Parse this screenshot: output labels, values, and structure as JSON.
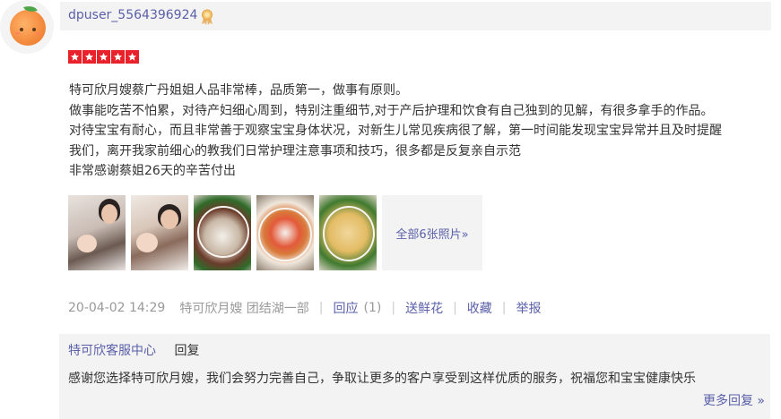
{
  "user": {
    "name": "dpuser_5564396924",
    "avatar_icon": "orange-avatar-icon",
    "badge_icon": "medal-badge-icon"
  },
  "rating": {
    "stars": 5,
    "max": 5,
    "color": "#e8212a"
  },
  "review_lines": [
    "特可欣月嫂蔡广丹姐姐人品非常棒，品质第一，做事有原则。",
    "做事能吃苦不怕累，对待产妇细心周到，特别注重细节,对于产后护理和饮食有自己独到的见解，有很多拿手的作品。",
    "对待宝宝有耐心，而且非常善于观察宝宝身体状况，对新生儿常见疾病很了解，第一时间能发现宝宝异常并且及时提醒",
    "我们，离开我家前细心的教我们日常护理注意事项和技巧，很多都是反复亲自示范",
    "非常感谢蔡姐26天的辛苦付出"
  ],
  "photos": {
    "items": [
      "photo-mother-baby-1",
      "photo-mother-baby-2",
      "photo-dish-meat-veg",
      "photo-dish-tomato",
      "photo-dish-fried"
    ],
    "more_label": "全部6张照片»"
  },
  "meta": {
    "datetime": "20-04-02 14:29",
    "shop": "特可欣月嫂 团结湖一部",
    "reply_label": "回应",
    "reply_count": "(1)",
    "flower_label": "送鲜花",
    "favorite_label": "收藏",
    "report_label": "举报"
  },
  "merchant_reply": {
    "merchant": "特可欣客服中心",
    "label": "回复",
    "text": "感谢您选择特可欣月嫂，我们会努力完善自己，争取让更多的客户享受到这样优质的服务，祝福您和宝宝健康快乐",
    "more_label": "更多回复 »"
  },
  "colors": {
    "link": "#5a5fa8",
    "muted": "#999999",
    "panel": "#f3f3f3"
  }
}
